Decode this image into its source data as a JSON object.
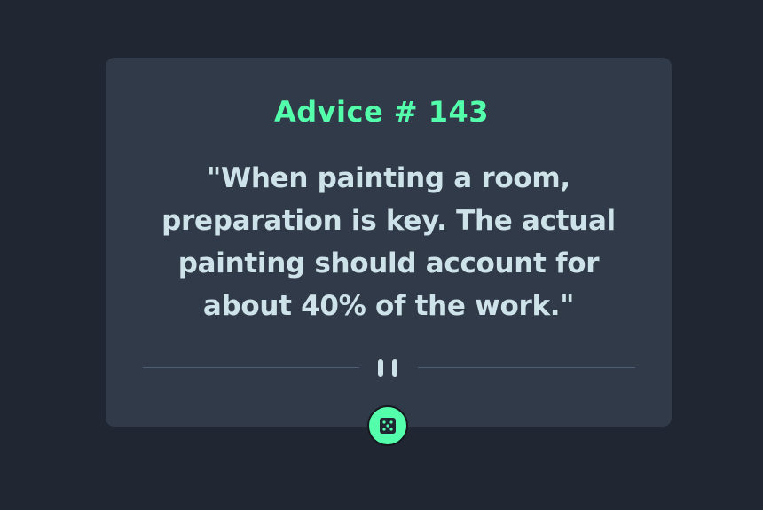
{
  "advice": {
    "title": "Advice # 143",
    "quote": "\"When painting a room, preparation is key. The actual painting should account for about 40% of the work.\""
  },
  "divider": {
    "icon": "pause-icon"
  },
  "dice_button": {
    "icon": "dice-icon"
  },
  "colors": {
    "background": "#202632",
    "card": "#313a49",
    "accent": "#53ffaa",
    "text": "#cee3e9",
    "divider": "#4f5d74"
  }
}
